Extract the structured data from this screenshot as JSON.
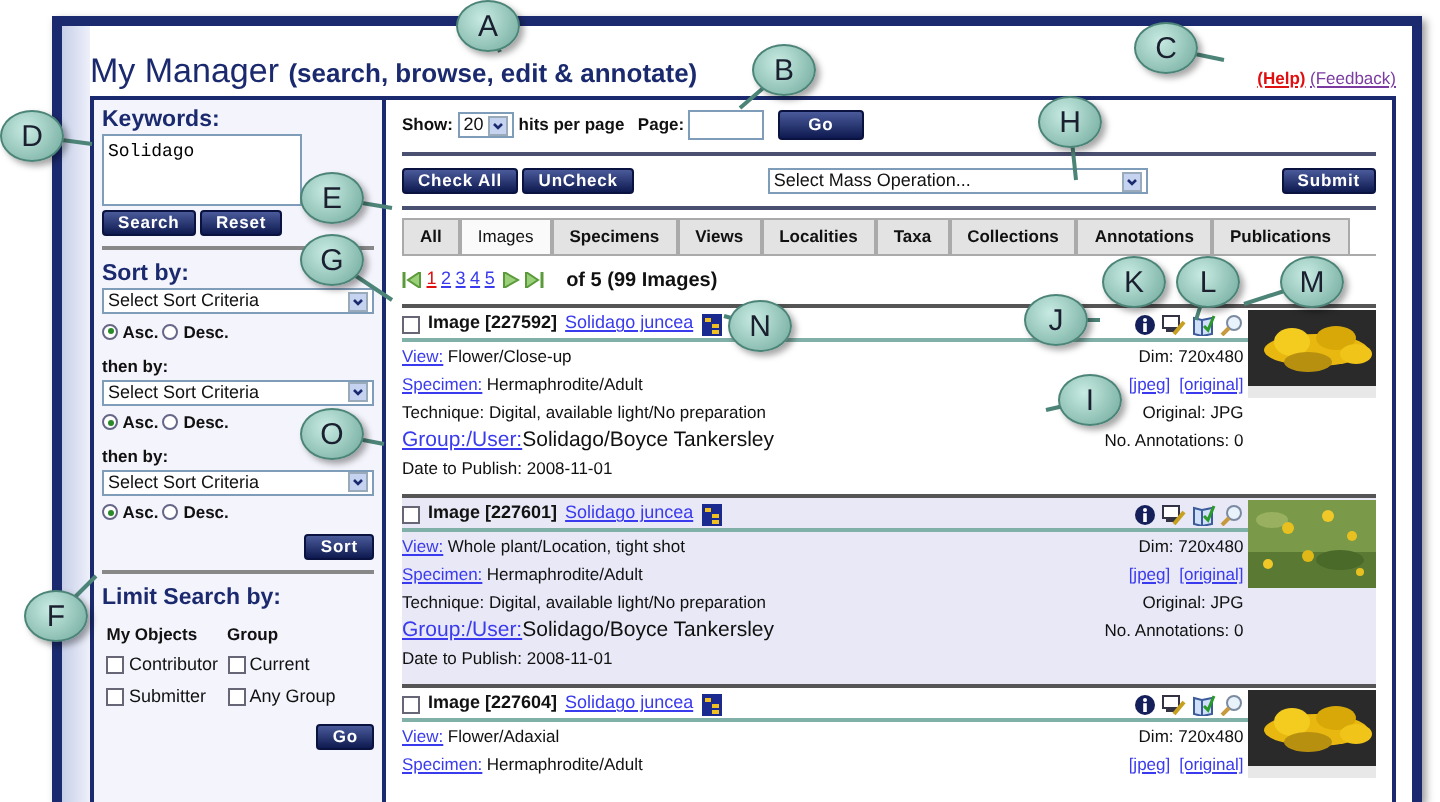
{
  "app": {
    "title": "My Manager",
    "subtitle": "(search, browse, edit & annotate)",
    "help": "(Help)",
    "feedback": "(Feedback)"
  },
  "keywords": {
    "label": "Keywords:",
    "value": "Solidago",
    "buttons": [
      "Search",
      "Reset"
    ]
  },
  "sort": {
    "title": "Sort by:",
    "button": "Sort",
    "criteria": [
      {
        "placeholder": "Select Sort Criteria",
        "options": [
          {
            "label": "Asc.",
            "selected": true
          },
          {
            "label": "Desc.",
            "selected": false
          }
        ]
      },
      {
        "label": "then by:",
        "placeholder": "Select Sort Criteria",
        "options": [
          {
            "label": "Asc.",
            "selected": true
          },
          {
            "label": "Desc.",
            "selected": false
          }
        ]
      },
      {
        "label": "then by:",
        "placeholder": "Select Sort Criteria",
        "options": [
          {
            "label": "Asc.",
            "selected": true
          },
          {
            "label": "Desc.",
            "selected": false
          }
        ]
      }
    ]
  },
  "limit": {
    "title": "Limit Search by:",
    "button": "Go",
    "columns": [
      {
        "heading": "My Objects",
        "options": [
          {
            "label": "Contributor",
            "checked": false
          },
          {
            "label": "Submitter",
            "checked": false
          }
        ]
      },
      {
        "heading": "Group",
        "options": [
          {
            "label": "Current",
            "checked": false
          },
          {
            "label": "Any Group",
            "checked": false
          }
        ]
      }
    ]
  },
  "toolbar": {
    "show_label": "Show:",
    "per_page": "20",
    "hits_label": "hits per page",
    "page_label": "Page:",
    "go": "Go"
  },
  "mass": {
    "check_all": "Check All",
    "uncheck": "UnCheck",
    "select": "Select Mass Operation...",
    "submit": "Submit"
  },
  "tabs": [
    {
      "label": "All",
      "selected": false
    },
    {
      "label": "Images",
      "selected": true
    },
    {
      "label": "Specimens",
      "selected": false
    },
    {
      "label": "Views",
      "selected": false
    },
    {
      "label": "Localities",
      "selected": false
    },
    {
      "label": "Taxa",
      "selected": false
    },
    {
      "label": "Collections",
      "selected": false
    },
    {
      "label": "Annotations",
      "selected": false
    },
    {
      "label": "Publications",
      "selected": false
    }
  ],
  "pager": {
    "pages": [
      {
        "label": "1",
        "selected": true
      },
      {
        "label": "2",
        "selected": false
      },
      {
        "label": "3",
        "selected": false
      },
      {
        "label": "4",
        "selected": false
      },
      {
        "label": "5",
        "selected": false
      }
    ],
    "summary": "of 5 (99 Images)"
  },
  "images": [
    {
      "checked": false,
      "title": "Image [227592]",
      "taxon": "Solidago juncea",
      "kind": "dark",
      "fields": [
        {
          "kind": "link",
          "label": "View:",
          "value": "Flower/Close-up"
        },
        {
          "kind": "link",
          "label": "Specimen:",
          "value": "Hermaphrodite/Adult"
        },
        {
          "kind": "plain",
          "value": "Technique: Digital, available light/No preparation"
        },
        {
          "kind": "owner",
          "label": "Group:/User:",
          "value": "Solidago/Boyce Tankersley"
        },
        {
          "kind": "plain",
          "value": "Date to Publish: 2008-11-01"
        }
      ],
      "dim": "Dim: 720x480",
      "links": [
        "[jpeg]",
        "[original]"
      ],
      "original": "Original: JPG",
      "annotations": "No. Annotations: 0"
    },
    {
      "checked": false,
      "title": "Image [227601]",
      "taxon": "Solidago juncea",
      "kind": "field",
      "fields": [
        {
          "kind": "link",
          "label": "View:",
          "value": "Whole plant/Location, tight shot"
        },
        {
          "kind": "link",
          "label": "Specimen:",
          "value": "Hermaphrodite/Adult"
        },
        {
          "kind": "plain",
          "value": "Technique: Digital, available light/No preparation"
        },
        {
          "kind": "owner",
          "label": "Group:/User:",
          "value": "Solidago/Boyce Tankersley"
        },
        {
          "kind": "plain",
          "value": "Date to Publish: 2008-11-01"
        }
      ],
      "dim": "Dim: 720x480",
      "links": [
        "[jpeg]",
        "[original]"
      ],
      "original": "Original: JPG",
      "annotations": "No. Annotations: 0"
    },
    {
      "checked": false,
      "title": "Image [227604]",
      "taxon": "Solidago juncea",
      "kind": "dark",
      "fields": [
        {
          "kind": "link",
          "label": "View:",
          "value": "Flower/Adaxial"
        },
        {
          "kind": "link",
          "label": "Specimen:",
          "value": "Hermaphrodite/Adult"
        }
      ],
      "dim": "Dim: 720x480",
      "links": [
        "[jpeg]",
        "[original]"
      ]
    }
  ],
  "callouts": [
    {
      "letter": "A"
    },
    {
      "letter": "B"
    },
    {
      "letter": "C"
    },
    {
      "letter": "D"
    },
    {
      "letter": "E"
    },
    {
      "letter": "F"
    },
    {
      "letter": "G"
    },
    {
      "letter": "H"
    },
    {
      "letter": "I"
    },
    {
      "letter": "J"
    },
    {
      "letter": "K"
    },
    {
      "letter": "L"
    },
    {
      "letter": "M"
    },
    {
      "letter": "N"
    },
    {
      "letter": "O"
    }
  ]
}
